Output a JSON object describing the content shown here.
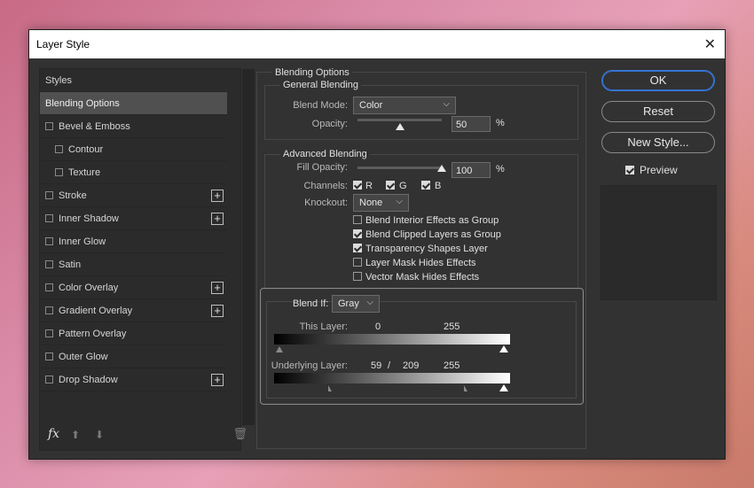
{
  "window": {
    "title": "Layer Style"
  },
  "sidebar": {
    "items": [
      {
        "label": "Styles",
        "checkbox": false,
        "plus": false,
        "indent": false,
        "active": false
      },
      {
        "label": "Blending Options",
        "checkbox": false,
        "plus": false,
        "indent": false,
        "active": true
      },
      {
        "label": "Bevel & Emboss",
        "checkbox": true,
        "plus": false,
        "indent": false,
        "active": false
      },
      {
        "label": "Contour",
        "checkbox": true,
        "plus": false,
        "indent": true,
        "active": false
      },
      {
        "label": "Texture",
        "checkbox": true,
        "plus": false,
        "indent": true,
        "active": false
      },
      {
        "label": "Stroke",
        "checkbox": true,
        "plus": true,
        "indent": false,
        "active": false
      },
      {
        "label": "Inner Shadow",
        "checkbox": true,
        "plus": true,
        "indent": false,
        "active": false
      },
      {
        "label": "Inner Glow",
        "checkbox": true,
        "plus": false,
        "indent": false,
        "active": false
      },
      {
        "label": "Satin",
        "checkbox": true,
        "plus": false,
        "indent": false,
        "active": false
      },
      {
        "label": "Color Overlay",
        "checkbox": true,
        "plus": true,
        "indent": false,
        "active": false
      },
      {
        "label": "Gradient Overlay",
        "checkbox": true,
        "plus": true,
        "indent": false,
        "active": false
      },
      {
        "label": "Pattern Overlay",
        "checkbox": true,
        "plus": false,
        "indent": false,
        "active": false
      },
      {
        "label": "Outer Glow",
        "checkbox": true,
        "plus": false,
        "indent": false,
        "active": false
      },
      {
        "label": "Drop Shadow",
        "checkbox": true,
        "plus": true,
        "indent": false,
        "active": false
      }
    ],
    "footer": {
      "fx": "fx"
    }
  },
  "blending": {
    "section_title": "Blending Options",
    "general": {
      "title": "General Blending",
      "blend_mode_label": "Blend Mode:",
      "blend_mode_value": "Color",
      "opacity_label": "Opacity:",
      "opacity_value": "50",
      "opacity_fraction": 0.5,
      "percent": "%"
    },
    "advanced": {
      "title": "Advanced Blending",
      "fill_opacity_label": "Fill Opacity:",
      "fill_opacity_value": "100",
      "fill_opacity_fraction": 1.0,
      "percent": "%",
      "channels_label": "Channels:",
      "channels": [
        {
          "label": "R",
          "checked": true
        },
        {
          "label": "G",
          "checked": true
        },
        {
          "label": "B",
          "checked": true
        }
      ],
      "knockout_label": "Knockout:",
      "knockout_value": "None",
      "options": [
        {
          "label": "Blend Interior Effects as Group",
          "checked": false
        },
        {
          "label": "Blend Clipped Layers as Group",
          "checked": true
        },
        {
          "label": "Transparency Shapes Layer",
          "checked": true
        },
        {
          "label": "Layer Mask Hides Effects",
          "checked": false
        },
        {
          "label": "Vector Mask Hides Effects",
          "checked": false
        }
      ]
    },
    "blend_if": {
      "label": "Blend If:",
      "value": "Gray",
      "this_layer_label": "This Layer:",
      "this_layer_low": "0",
      "this_layer_high": "255",
      "underlying_label": "Underlying Layer:",
      "underlying_low": "59",
      "underlying_sep": "/",
      "underlying_mid": "209",
      "underlying_high": "255"
    }
  },
  "buttons": {
    "ok": "OK",
    "reset": "Reset",
    "new_style": "New Style...",
    "preview_label": "Preview",
    "preview_checked": true
  }
}
